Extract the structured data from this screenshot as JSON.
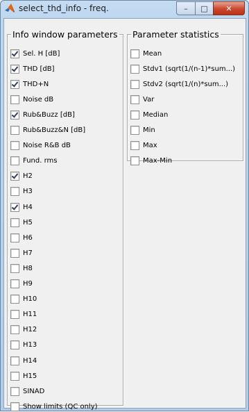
{
  "window": {
    "title": "select_thd_info - freq.",
    "minimize_label": "–",
    "maximize_label": "□",
    "close_label": "✕"
  },
  "info_group": {
    "title": "Info window parameters",
    "items": [
      {
        "label": "Sel. H [dB]",
        "checked": true
      },
      {
        "label": "THD [dB]",
        "checked": true
      },
      {
        "label": "THD+N",
        "checked": true
      },
      {
        "label": "Noise dB",
        "checked": false
      },
      {
        "label": "Rub&Buzz [dB]",
        "checked": true
      },
      {
        "label": "Rub&Buzz&N [dB]",
        "checked": false
      },
      {
        "label": "Noise R&B dB",
        "checked": false
      },
      {
        "label": "Fund. rms",
        "checked": false
      },
      {
        "label": "H2",
        "checked": true
      },
      {
        "label": "H3",
        "checked": false
      },
      {
        "label": "H4",
        "checked": true
      },
      {
        "label": "H5",
        "checked": false
      },
      {
        "label": "H6",
        "checked": false
      },
      {
        "label": "H7",
        "checked": false
      },
      {
        "label": "H8",
        "checked": false
      },
      {
        "label": "H9",
        "checked": false
      },
      {
        "label": "H10",
        "checked": false
      },
      {
        "label": "H11",
        "checked": false
      },
      {
        "label": "H12",
        "checked": false
      },
      {
        "label": "H13",
        "checked": false
      },
      {
        "label": "H14",
        "checked": false
      },
      {
        "label": "H15",
        "checked": false
      },
      {
        "label": "SINAD",
        "checked": false
      },
      {
        "label": "Show limits (QC only)",
        "checked": false
      }
    ]
  },
  "stats_group": {
    "title": "Parameter statistics",
    "items": [
      {
        "label": "Mean",
        "checked": false
      },
      {
        "label": "Stdv1 (sqrt(1/(n-1)*sum...)",
        "checked": false
      },
      {
        "label": "Stdv2 (sqrt(1/(n)*sum...)",
        "checked": false
      },
      {
        "label": "Var",
        "checked": false
      },
      {
        "label": "Median",
        "checked": false
      },
      {
        "label": "Min",
        "checked": false
      },
      {
        "label": "Max",
        "checked": false
      },
      {
        "label": "Max-Min",
        "checked": false
      }
    ]
  }
}
